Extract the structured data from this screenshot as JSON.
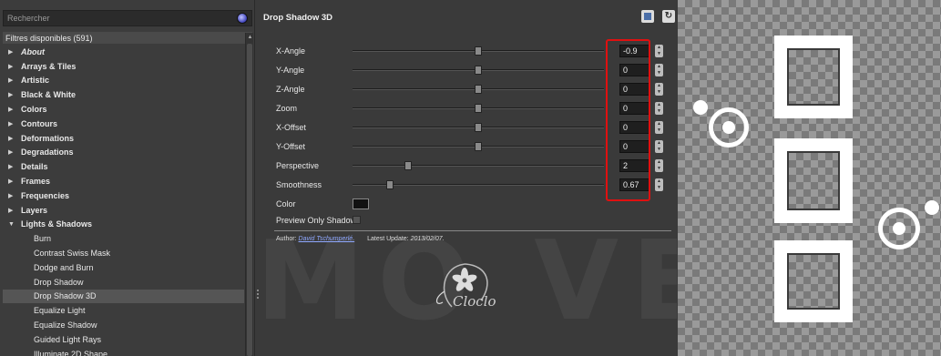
{
  "left_panel": {
    "search_placeholder": "Rechercher",
    "available_header": "Filtres disponibles (591)",
    "tree": [
      {
        "label": "About",
        "type": "cat-italic"
      },
      {
        "label": "Arrays & Tiles",
        "type": "cat"
      },
      {
        "label": "Artistic",
        "type": "cat"
      },
      {
        "label": "Black & White",
        "type": "cat"
      },
      {
        "label": "Colors",
        "type": "cat"
      },
      {
        "label": "Contours",
        "type": "cat"
      },
      {
        "label": "Deformations",
        "type": "cat"
      },
      {
        "label": "Degradations",
        "type": "cat"
      },
      {
        "label": "Details",
        "type": "cat"
      },
      {
        "label": "Frames",
        "type": "cat"
      },
      {
        "label": "Frequencies",
        "type": "cat"
      },
      {
        "label": "Layers",
        "type": "cat"
      },
      {
        "label": "Lights & Shadows",
        "type": "cat-open"
      },
      {
        "label": "Burn",
        "type": "child"
      },
      {
        "label": "Contrast Swiss Mask",
        "type": "child"
      },
      {
        "label": "Dodge and Burn",
        "type": "child"
      },
      {
        "label": "Drop Shadow",
        "type": "child"
      },
      {
        "label": "Drop Shadow 3D",
        "type": "child-selected"
      },
      {
        "label": "Equalize Light",
        "type": "child"
      },
      {
        "label": "Equalize Shadow",
        "type": "child"
      },
      {
        "label": "Guided Light Rays",
        "type": "child"
      },
      {
        "label": "Illuminate 2D Shape",
        "type": "child"
      }
    ]
  },
  "filter_panel": {
    "title": "Drop Shadow 3D",
    "params": [
      {
        "label": "X-Angle",
        "value": "-0.9",
        "level": 0.5
      },
      {
        "label": "Y-Angle",
        "value": "0",
        "level": 0.5
      },
      {
        "label": "Z-Angle",
        "value": "0",
        "level": 0.5
      },
      {
        "label": "Zoom",
        "value": "0",
        "level": 0.5
      },
      {
        "label": "X-Offset",
        "value": "0",
        "level": 0.5
      },
      {
        "label": "Y-Offset",
        "value": "0",
        "level": 0.5
      },
      {
        "label": "Perspective",
        "value": "2",
        "level": 0.22
      },
      {
        "label": "Smoothness",
        "value": "0.67",
        "level": 0.15
      }
    ],
    "color_label": "Color",
    "color_value": "#111111",
    "preview_label": "Preview Only Shadow",
    "author_label": "Author:",
    "author_name": "David Tschumperlé.",
    "update_label": "Latest Update:",
    "update_date": "2013/02/07.",
    "watermark_text": "MO VER",
    "logo_text": "Cloclo"
  }
}
